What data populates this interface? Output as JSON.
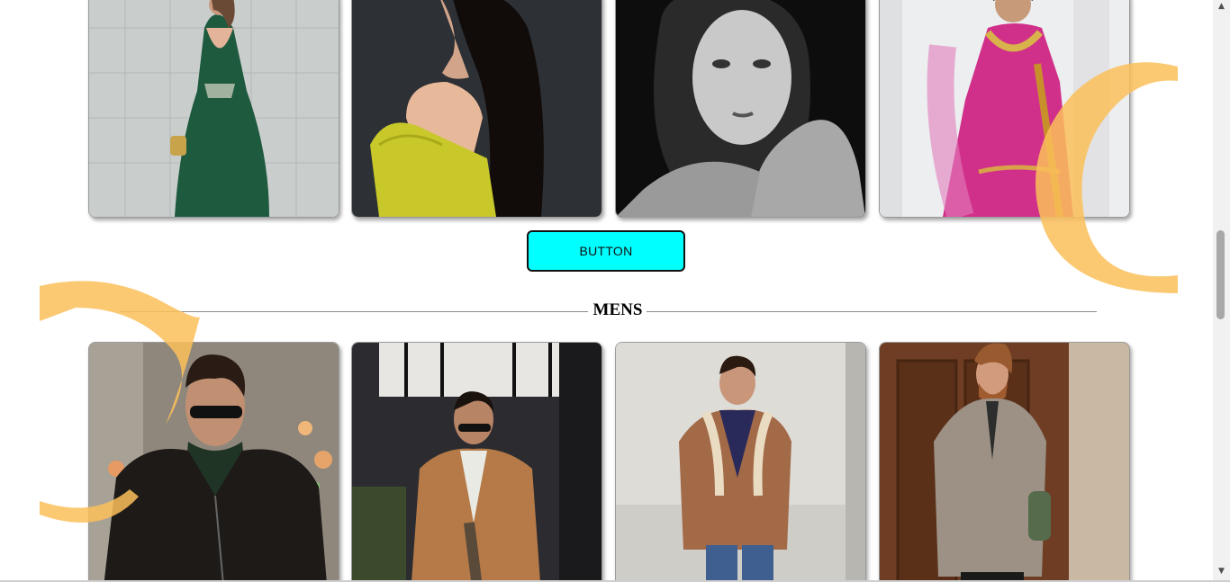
{
  "womens_gallery": {
    "cards": [
      {
        "icon": "woman-green-dress-photo"
      },
      {
        "icon": "woman-yellow-sweater-photo"
      },
      {
        "icon": "woman-bw-portrait-photo"
      },
      {
        "icon": "woman-pink-lehenga-photo"
      }
    ]
  },
  "action": {
    "button_label": "BUTTON"
  },
  "mens_section": {
    "title": "MENS",
    "cards": [
      {
        "icon": "man-leather-jacket-photo"
      },
      {
        "icon": "man-camel-blazer-photo"
      },
      {
        "icon": "man-shearling-coat-photo"
      },
      {
        "icon": "man-tweed-overcoat-photo"
      }
    ]
  },
  "colors": {
    "button_bg": "#00ffff",
    "decoration": "#fbbf5a",
    "divider": "#8a8a8a"
  }
}
